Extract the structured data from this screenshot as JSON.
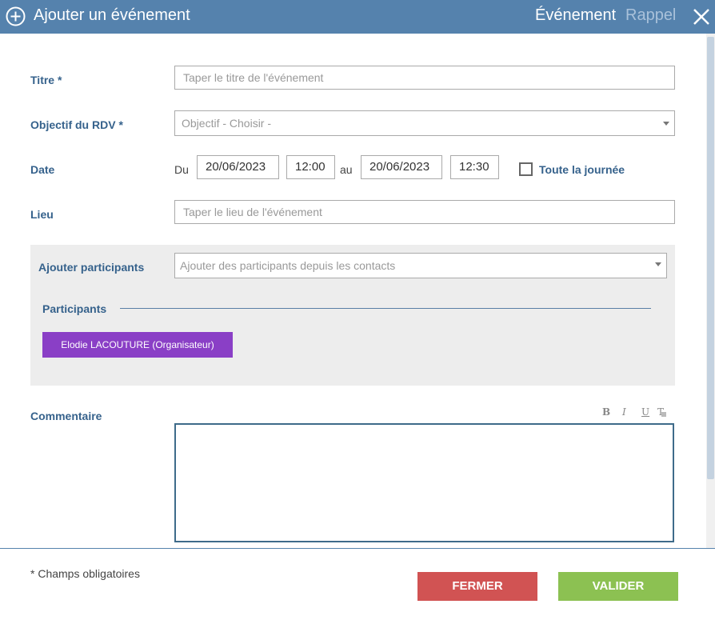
{
  "header": {
    "title": "Ajouter un événement",
    "tab_event": "Événement",
    "tab_reminder": "Rappel",
    "color": "#5582ad"
  },
  "form": {
    "title_label": "Titre *",
    "title_placeholder": "Taper le titre de l'événement",
    "objective_label": "Objectif du RDV *",
    "objective_value": "Objectif - Choisir -",
    "date_label": "Date",
    "date_from_prefix": "Du",
    "date_from": "20/06/2023",
    "time_from": "12:00",
    "date_to_prefix": "au",
    "date_to": "20/06/2023",
    "time_to": "12:30",
    "all_day_label": "Toute la journée",
    "place_label": "Lieu",
    "place_placeholder": "Taper le lieu de l'événement"
  },
  "participants": {
    "add_label": "Ajouter participants",
    "add_placeholder": "Ajouter des participants depuis les contacts",
    "section_title": "Participants",
    "items": [
      {
        "name": "Elodie LACOUTURE (Organisateur)",
        "color": "#8a3fc6"
      }
    ]
  },
  "comment": {
    "label": "Commentaire",
    "toolbar": {
      "bold": "B",
      "italic": "I",
      "underline": "U",
      "clear": "T"
    }
  },
  "footer": {
    "required_note": "* Champs obligatoires",
    "close_button": "FERMER",
    "validate_button": "VALIDER",
    "close_color": "#d15353",
    "validate_color": "#8cc152"
  }
}
